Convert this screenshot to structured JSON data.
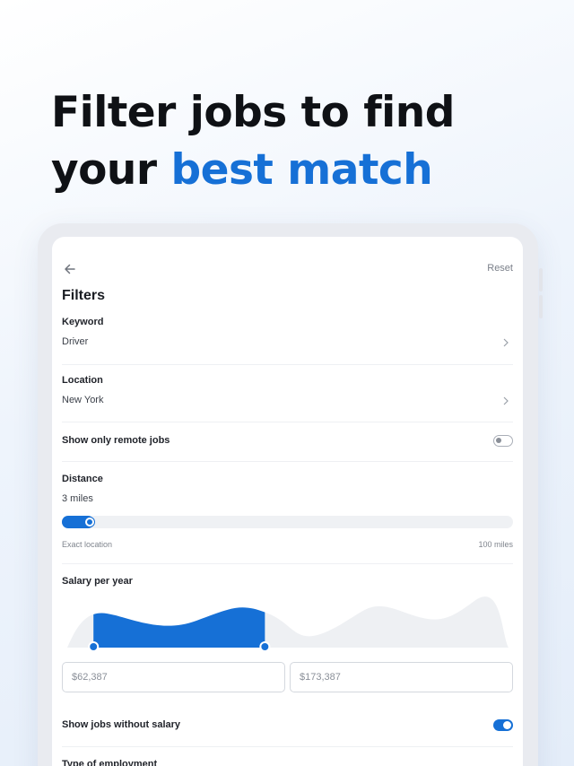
{
  "headline": {
    "line1": "Filter jobs to find",
    "line2_plain": "your ",
    "line2_accent": "best match"
  },
  "header": {
    "back_icon": "arrow-left-icon",
    "reset_label": "Reset",
    "title": "Filters"
  },
  "keyword": {
    "label": "Keyword",
    "value": "Driver"
  },
  "location": {
    "label": "Location",
    "value": "New York"
  },
  "remote": {
    "label": "Show only remote jobs",
    "enabled": false
  },
  "distance": {
    "label": "Distance",
    "value": "3 miles",
    "min_label": "Exact location",
    "max_label": "100 miles",
    "fraction": 0.06
  },
  "salary": {
    "label": "Salary per year",
    "min_value": "$62,387",
    "max_value": "$173,387",
    "range_fraction": [
      0.07,
      0.45
    ]
  },
  "no_salary": {
    "label": "Show jobs without salary",
    "enabled": true
  },
  "employment": {
    "label": "Type of employment"
  },
  "colors": {
    "accent": "#1670d6",
    "chart_inactive": "#eef0f3"
  }
}
